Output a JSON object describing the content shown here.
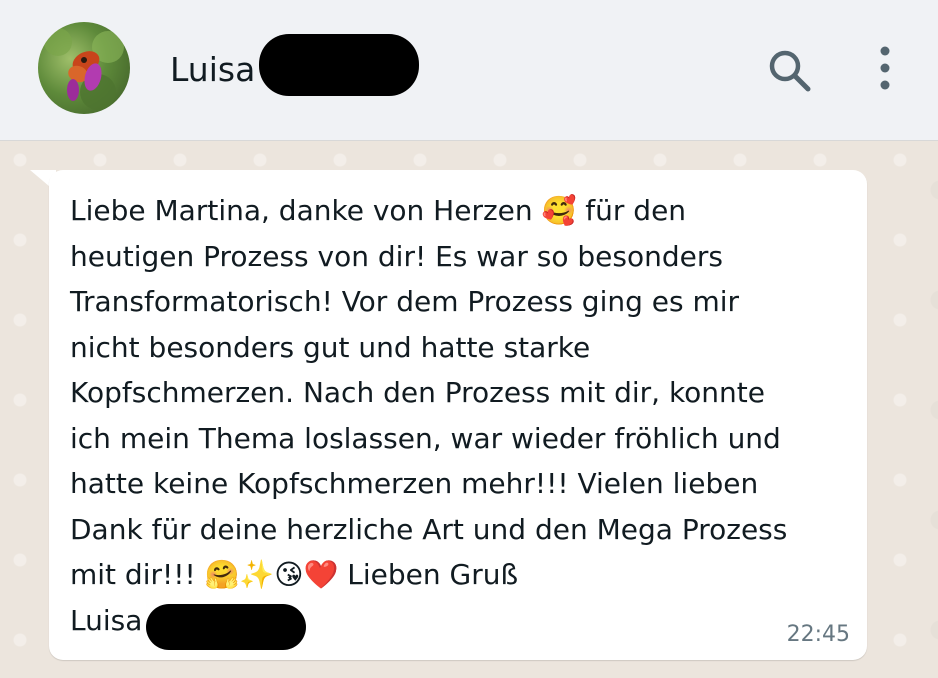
{
  "header": {
    "contact_name": "Luisa",
    "search_icon": "search-icon",
    "menu_icon": "more-vertical-icon"
  },
  "message": {
    "text": "Liebe Martina, danke von Herzen 🥰 für den\nheutigen Prozess von dir! Es war so besonders\nTransformatorisch! Vor dem Prozess ging es mir\nnicht besonders gut und hatte starke\nKopfschmerzen. Nach den Prozess mit dir, konnte\nich mein Thema loslassen, war wieder fröhlich und\nhatte keine Kopfschmerzen mehr!!! Vielen lieben\nDank für deine herzliche Art und den Mega Prozess\nmit dir!!! 🤗✨😘❤️ Lieben Gruß",
    "signature": "Luisa",
    "time": "22:45"
  },
  "colors": {
    "header_bg": "#f0f2f5",
    "chat_bg": "#ece5dd",
    "bubble_bg": "#ffffff",
    "icon": "#54656f",
    "timestamp": "#667781"
  }
}
